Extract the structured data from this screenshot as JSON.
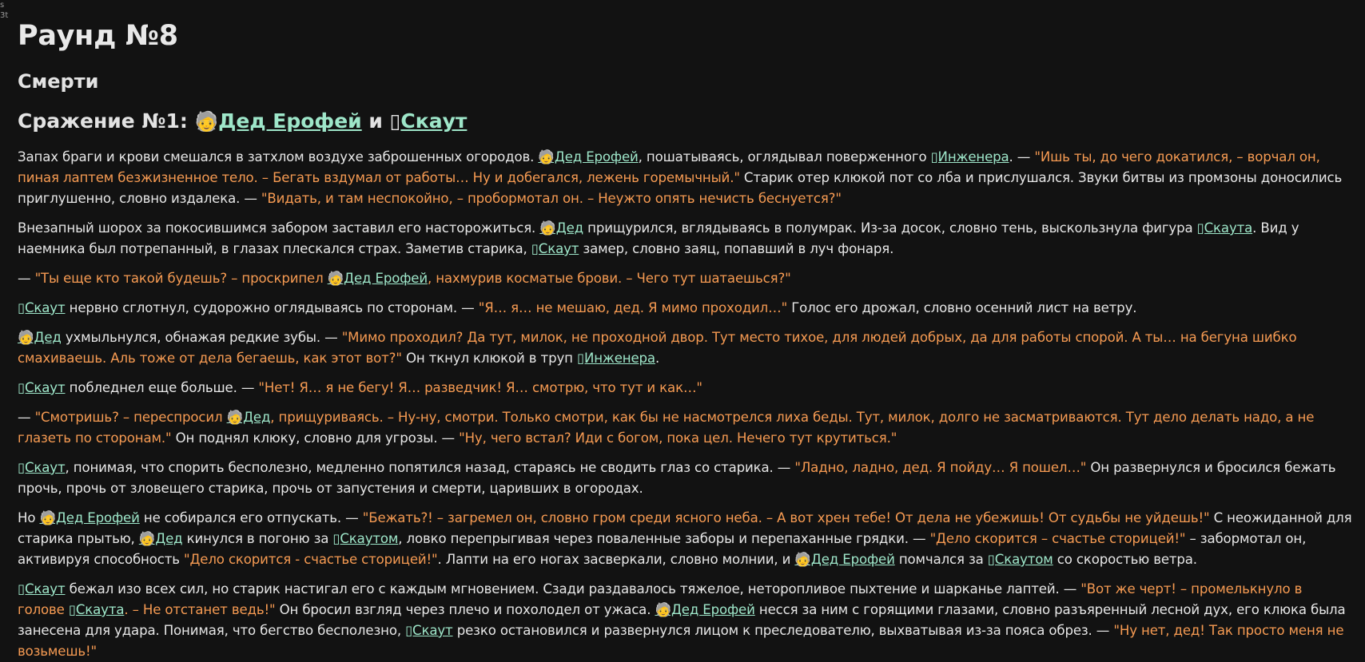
{
  "corner_text": [
    "s",
    "3t"
  ],
  "round_title": "Раунд №8",
  "section_title": "Смерти",
  "battle": {
    "prefix": "Сражение №1: ",
    "fighter1_icon": "🧓",
    "fighter1": "Дед Ерофей",
    "conj": " и ",
    "fighter2_icon": "▯",
    "fighter2": "Скаут"
  },
  "paragraphs": [
    [
      {
        "t": "text",
        "v": "Запах браги и крови смешался в затхлом воздухе заброшенных огородов. "
      },
      {
        "t": "link",
        "v": "🧓Дед Ерофей"
      },
      {
        "t": "text",
        "v": ", пошатываясь, оглядывал поверженного "
      },
      {
        "t": "link",
        "v": "▯Инженера"
      },
      {
        "t": "text",
        "v": ". — "
      },
      {
        "t": "quote",
        "v": "\"Ишь ты, до чего докатился, – ворчал он, пиная лаптем безжизненное тело. – Бегать вздумал от работы… Ну и добегался, лежень горемычный.\""
      },
      {
        "t": "text",
        "v": " Старик отер клюкой пот со лба и прислушался. Звуки битвы из промзоны доносились приглушенно, словно издалека. — "
      },
      {
        "t": "quote",
        "v": "\"Видать, и там неспокойно, – пробормотал он. – Неужто опять нечисть беснуется?\""
      }
    ],
    [
      {
        "t": "text",
        "v": "Внезапный шорох за покосившимся забором заставил его насторожиться. "
      },
      {
        "t": "link",
        "v": "🧓Дед"
      },
      {
        "t": "text",
        "v": " прищурился, вглядываясь в полумрак. Из-за досок, словно тень, выскользнула фигура "
      },
      {
        "t": "link",
        "v": "▯Скаута"
      },
      {
        "t": "text",
        "v": ". Вид у наемника был потрепанный, в глазах плескался страх. Заметив старика, "
      },
      {
        "t": "link",
        "v": "▯Скаут"
      },
      {
        "t": "text",
        "v": " замер, словно заяц, попавший в луч фонаря."
      }
    ],
    [
      {
        "t": "text",
        "v": "— "
      },
      {
        "t": "quote",
        "v": "\"Ты еще кто такой будешь? – проскрипел "
      },
      {
        "t": "link",
        "v": "🧓Дед Ерофей"
      },
      {
        "t": "quote",
        "v": ", нахмурив косматые брови. – Чего тут шатаешься?\""
      }
    ],
    [
      {
        "t": "link",
        "v": "▯Скаут"
      },
      {
        "t": "text",
        "v": " нервно сглотнул, судорожно оглядываясь по сторонам. — "
      },
      {
        "t": "quote",
        "v": "\"Я… я… не мешаю, дед. Я мимо проходил…\""
      },
      {
        "t": "text",
        "v": " Голос его дрожал, словно осенний лист на ветру."
      }
    ],
    [
      {
        "t": "link",
        "v": "🧓Дед"
      },
      {
        "t": "text",
        "v": " ухмыльнулся, обнажая редкие зубы. — "
      },
      {
        "t": "quote",
        "v": "\"Мимо проходил? Да тут, милок, не проходной двор. Тут место тихое, для людей добрых, да для работы спорой. А ты… на бегуна шибко смахиваешь. Аль тоже от дела бегаешь, как этот вот?\""
      },
      {
        "t": "text",
        "v": " Он ткнул клюкой в труп "
      },
      {
        "t": "link",
        "v": "▯Инженера"
      },
      {
        "t": "text",
        "v": "."
      }
    ],
    [
      {
        "t": "link",
        "v": "▯Скаут"
      },
      {
        "t": "text",
        "v": " побледнел еще больше. — "
      },
      {
        "t": "quote",
        "v": "\"Нет! Я… я не бегу! Я… разведчик! Я… смотрю, что тут и как…\""
      }
    ],
    [
      {
        "t": "text",
        "v": "— "
      },
      {
        "t": "quote",
        "v": "\"Смотришь? – переспросил "
      },
      {
        "t": "link",
        "v": "🧓Дед"
      },
      {
        "t": "quote",
        "v": ", прищуриваясь. – Ну-ну, смотри. Только смотри, как бы не насмотрелся лиха беды. Тут, милок, долго не засматриваются. Тут дело делать надо, а не глазеть по сторонам.\""
      },
      {
        "t": "text",
        "v": " Он поднял клюку, словно для угрозы. — "
      },
      {
        "t": "quote",
        "v": "\"Ну, чего встал? Иди с богом, пока цел. Нечего тут крутиться.\""
      }
    ],
    [
      {
        "t": "link",
        "v": "▯Скаут"
      },
      {
        "t": "text",
        "v": ", понимая, что спорить бесполезно, медленно попятился назад, стараясь не сводить глаз со старика. — "
      },
      {
        "t": "quote",
        "v": "\"Ладно, ладно, дед. Я пойду… Я пошел…\""
      },
      {
        "t": "text",
        "v": " Он развернулся и бросился бежать прочь, прочь от зловещего старика, прочь от запустения и смерти, царивших в огородах."
      }
    ],
    [
      {
        "t": "text",
        "v": "Но "
      },
      {
        "t": "link",
        "v": "🧓Дед Ерофей"
      },
      {
        "t": "text",
        "v": " не собирался его отпускать. — "
      },
      {
        "t": "quote",
        "v": "\"Бежать?! – загремел он, словно гром среди ясного неба. – А вот хрен тебе! От дела не убежишь! От судьбы не уйдешь!\""
      },
      {
        "t": "text",
        "v": " С неожиданной для старика прытью, "
      },
      {
        "t": "link",
        "v": "🧓Дед"
      },
      {
        "t": "text",
        "v": " кинулся в погоню за "
      },
      {
        "t": "link",
        "v": "▯Скаутом"
      },
      {
        "t": "text",
        "v": ", ловко перепрыгивая через поваленные заборы и перепаханные грядки. — "
      },
      {
        "t": "quote",
        "v": "\"Дело скорится – счастье сторицей!\""
      },
      {
        "t": "text",
        "v": " – забормотал он, активируя способность "
      },
      {
        "t": "quote",
        "v": "\"Дело скорится - счастье сторицей!\""
      },
      {
        "t": "text",
        "v": ". Лапти на его ногах засверкали, словно молнии, и "
      },
      {
        "t": "link",
        "v": "🧓Дед Ерофей"
      },
      {
        "t": "text",
        "v": " помчался за "
      },
      {
        "t": "link",
        "v": "▯Скаутом"
      },
      {
        "t": "text",
        "v": " со скоростью ветра."
      }
    ],
    [
      {
        "t": "link",
        "v": "▯Скаут"
      },
      {
        "t": "text",
        "v": " бежал изо всех сил, но старик настигал его с каждым мгновением. Сзади раздавалось тяжелое, неторопливое пыхтение и шарканье лаптей. — "
      },
      {
        "t": "quote",
        "v": "\"Вот же черт! – промелькнуло в голове "
      },
      {
        "t": "link",
        "v": "▯Скаута"
      },
      {
        "t": "quote",
        "v": ". – Не отстанет ведь!\""
      },
      {
        "t": "text",
        "v": " Он бросил взгляд через плечо и похолодел от ужаса. "
      },
      {
        "t": "link",
        "v": "🧓Дед Ерофей"
      },
      {
        "t": "text",
        "v": " несся за ним с горящими глазами, словно разъяренный лесной дух, его клюка была занесена для удара. Понимая, что бегство бесполезно, "
      },
      {
        "t": "link",
        "v": "▯Скаут"
      },
      {
        "t": "text",
        "v": " резко остановился и развернулся лицом к преследователю, выхватывая из-за пояса обрез. — "
      },
      {
        "t": "quote",
        "v": "\"Ну нет, дед! Так просто меня не возьмешь!\""
      }
    ]
  ]
}
